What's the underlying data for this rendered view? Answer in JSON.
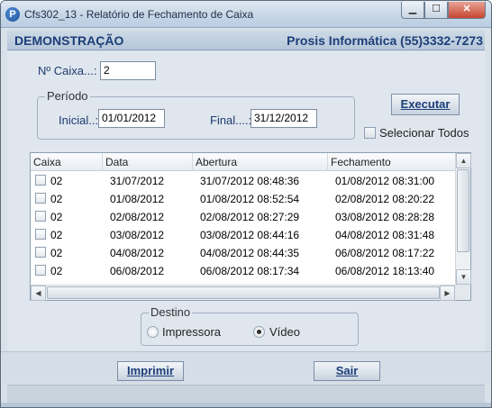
{
  "window": {
    "title": "Cfs302_13 - Relatório de Fechamento de Caixa",
    "icon_letter": "P",
    "controls": {
      "minimize": "▁",
      "maximize": "☐",
      "close": "✕"
    }
  },
  "header": {
    "left": "DEMONSTRAÇÃO",
    "right": "Prosis Informática (55)3332-7273"
  },
  "form": {
    "caixa_label": "Nº Caixa...:",
    "caixa_value": "2",
    "periodo_title": "Período",
    "inicial_label": "Inicial..:",
    "inicial_value": "01/01/2012",
    "final_label": "Final....:",
    "final_value": "31/12/2012",
    "executar": "Executar",
    "selecionar_todos": "Selecionar Todos"
  },
  "grid": {
    "columns": [
      "Caixa",
      "Data",
      "Abertura",
      "Fechamento"
    ],
    "rows": [
      [
        "02",
        "31/07/2012",
        "31/07/2012 08:48:36",
        "01/08/2012 08:31:00"
      ],
      [
        "02",
        "01/08/2012",
        "01/08/2012 08:52:54",
        "02/08/2012 08:20:22"
      ],
      [
        "02",
        "02/08/2012",
        "02/08/2012 08:27:29",
        "03/08/2012 08:28:28"
      ],
      [
        "02",
        "03/08/2012",
        "03/08/2012 08:44:16",
        "04/08/2012 08:31:48"
      ],
      [
        "02",
        "04/08/2012",
        "04/08/2012 08:44:35",
        "06/08/2012 08:17:22"
      ],
      [
        "02",
        "06/08/2012",
        "06/08/2012 08:17:34",
        "06/08/2012 18:13:40"
      ]
    ]
  },
  "destino": {
    "title": "Destino",
    "options": [
      "Impressora",
      "Vídeo"
    ],
    "selected": "Vídeo"
  },
  "buttons": {
    "imprimir": "Imprimir",
    "sair": "Sair"
  }
}
